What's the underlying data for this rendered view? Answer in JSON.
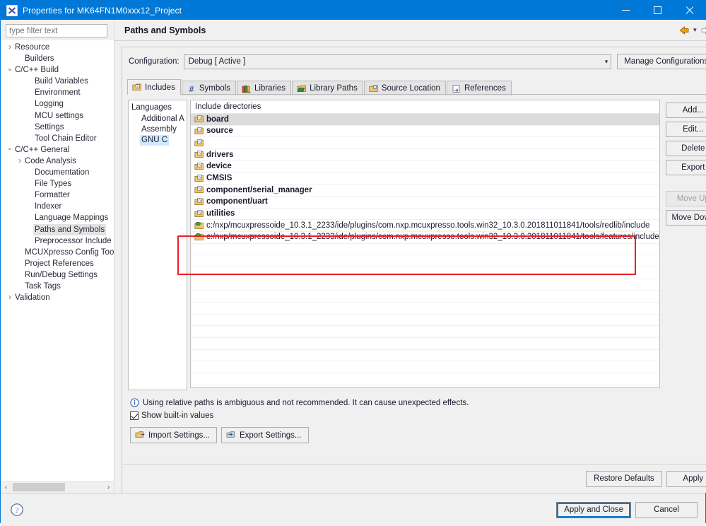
{
  "window": {
    "title": "Properties for MK64FN1M0xxx12_Project",
    "icon": "eclipse-x-icon",
    "minimize_label": "Minimize",
    "maximize_label": "Maximize",
    "close_label": "Close"
  },
  "filter": {
    "placeholder": "type filter text",
    "value": ""
  },
  "tree": {
    "items": [
      {
        "label": "Resource",
        "indent": 0,
        "twisty": "collapsed",
        "selected": false
      },
      {
        "label": "Builders",
        "indent": 1,
        "twisty": "none",
        "selected": false
      },
      {
        "label": "C/C++ Build",
        "indent": 0,
        "twisty": "expanded",
        "selected": false
      },
      {
        "label": "Build Variables",
        "indent": 2,
        "twisty": "none",
        "selected": false
      },
      {
        "label": "Environment",
        "indent": 2,
        "twisty": "none",
        "selected": false
      },
      {
        "label": "Logging",
        "indent": 2,
        "twisty": "none",
        "selected": false
      },
      {
        "label": "MCU settings",
        "indent": 2,
        "twisty": "none",
        "selected": false
      },
      {
        "label": "Settings",
        "indent": 2,
        "twisty": "none",
        "selected": false
      },
      {
        "label": "Tool Chain Editor",
        "indent": 2,
        "twisty": "none",
        "selected": false
      },
      {
        "label": "C/C++ General",
        "indent": 0,
        "twisty": "expanded",
        "selected": false
      },
      {
        "label": "Code Analysis",
        "indent": 1,
        "twisty": "collapsed",
        "selected": false
      },
      {
        "label": "Documentation",
        "indent": 2,
        "twisty": "none",
        "selected": false
      },
      {
        "label": "File Types",
        "indent": 2,
        "twisty": "none",
        "selected": false
      },
      {
        "label": "Formatter",
        "indent": 2,
        "twisty": "none",
        "selected": false
      },
      {
        "label": "Indexer",
        "indent": 2,
        "twisty": "none",
        "selected": false
      },
      {
        "label": "Language Mappings",
        "indent": 2,
        "twisty": "none",
        "selected": false
      },
      {
        "label": "Paths and Symbols",
        "indent": 2,
        "twisty": "none",
        "selected": true
      },
      {
        "label": "Preprocessor Include Pa",
        "indent": 2,
        "twisty": "none",
        "selected": false
      },
      {
        "label": "MCUXpresso Config Tools",
        "indent": 1,
        "twisty": "none",
        "selected": false
      },
      {
        "label": "Project References",
        "indent": 1,
        "twisty": "none",
        "selected": false
      },
      {
        "label": "Run/Debug Settings",
        "indent": 1,
        "twisty": "none",
        "selected": false
      },
      {
        "label": "Task Tags",
        "indent": 1,
        "twisty": "none",
        "selected": false
      },
      {
        "label": "Validation",
        "indent": 0,
        "twisty": "collapsed",
        "selected": false
      }
    ]
  },
  "page": {
    "title": "Paths and Symbols",
    "nav": {
      "back_label": "Back",
      "back_menu_label": "Back history",
      "forward_label": "Forward",
      "forward_menu_label": "Forward history",
      "view_menu_label": "View menu"
    }
  },
  "configuration": {
    "label": "Configuration:",
    "value": "Debug  [ Active ]",
    "manage_button": "Manage Configurations..."
  },
  "tabs": [
    {
      "label": "Includes",
      "icon": "include-folder-icon",
      "active": true
    },
    {
      "label": "Symbols",
      "icon": "hash-icon",
      "active": false
    },
    {
      "label": "Libraries",
      "icon": "books-icon",
      "active": false
    },
    {
      "label": "Library Paths",
      "icon": "library-folder-icon",
      "active": false
    },
    {
      "label": "Source Location",
      "icon": "source-folder-icon",
      "active": false
    },
    {
      "label": "References",
      "icon": "reference-page-icon",
      "active": false
    }
  ],
  "languages": {
    "header": "Languages",
    "items": [
      {
        "label": "Additional A",
        "selected": false
      },
      {
        "label": "Assembly",
        "selected": false
      },
      {
        "label": "GNU C",
        "selected": true
      }
    ]
  },
  "include_list": {
    "header": "Include directories",
    "rows": [
      {
        "label": "board",
        "icon": "header-folder-icon",
        "selected": true,
        "bold": true
      },
      {
        "label": "source",
        "icon": "header-folder-icon",
        "selected": false,
        "bold": true
      },
      {
        "label": "",
        "icon": "header-folder-icon",
        "selected": false,
        "bold": true
      },
      {
        "label": "drivers",
        "icon": "header-folder-icon",
        "selected": false,
        "bold": true
      },
      {
        "label": "device",
        "icon": "header-folder-icon",
        "selected": false,
        "bold": true
      },
      {
        "label": "CMSIS",
        "icon": "header-folder-icon",
        "selected": false,
        "bold": true
      },
      {
        "label": "component/serial_manager",
        "icon": "header-folder-icon",
        "selected": false,
        "bold": true
      },
      {
        "label": "component/uart",
        "icon": "header-folder-icon",
        "selected": false,
        "bold": true
      },
      {
        "label": "utilities",
        "icon": "header-folder-icon",
        "selected": false,
        "bold": true
      },
      {
        "label": "c:/nxp/mcuxpressoide_10.3.1_2233/ide/plugins/com.nxp.mcuxpresso.tools.win32_10.3.0.201811011841/tools/redlib/include",
        "icon": "builtin-folder-icon",
        "selected": false,
        "bold": false
      },
      {
        "label": "c:/nxp/mcuxpressoide_10.3.1_2233/ide/plugins/com.nxp.mcuxpresso.tools.win32_10.3.0.201811011841/tools/features/include",
        "icon": "builtin-folder-icon",
        "selected": false,
        "bold": false
      }
    ],
    "empty_row_count": 13
  },
  "side_buttons": [
    {
      "label": "Add...",
      "disabled": false
    },
    {
      "label": "Edit...",
      "disabled": false
    },
    {
      "label": "Delete",
      "disabled": false
    },
    {
      "label": "Export",
      "disabled": false
    },
    {
      "label": "Move Up",
      "disabled": true,
      "gap": true
    },
    {
      "label": "Move Down",
      "disabled": false
    }
  ],
  "note": {
    "icon": "info-icon",
    "text": "Using relative paths is ambiguous and not recommended. It can cause unexpected effects."
  },
  "show_builtin": {
    "label": "Show built-in values",
    "checked": true
  },
  "settings_buttons": [
    {
      "label": "Import Settings...",
      "icon": "import-icon"
    },
    {
      "label": "Export Settings...",
      "icon": "export-icon"
    }
  ],
  "apply_row": {
    "restore_defaults": "Restore Defaults",
    "apply": "Apply"
  },
  "footer": {
    "help_label": "Help",
    "apply_and_close": "Apply and Close",
    "cancel": "Cancel"
  },
  "annotation": {
    "color": "#ee1c25",
    "label": "highlighted-builtin-include-paths"
  },
  "colors": {
    "titlebar": "#0078d7",
    "accent": "#0078d7",
    "annotation": "#ee1c25",
    "selection_tree": "#e2e2e2",
    "selection_list": "#dcdcdc",
    "selection_language": "#cde8ff"
  }
}
